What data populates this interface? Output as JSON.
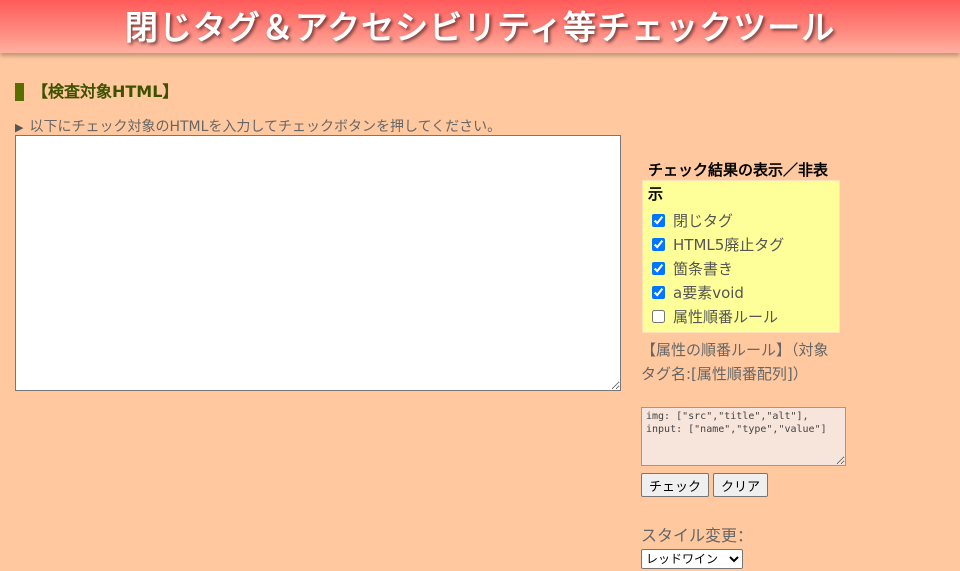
{
  "header": {
    "title": "閉じタグ＆アクセシビリティ等チェックツール"
  },
  "input_section": {
    "title": "【検査対象HTML】",
    "instruction": "以下にチェック対象のHTMLを入力してチェックボタンを押してください。",
    "input_value": ""
  },
  "display_toggle": {
    "title": "チェック結果の表示／非表示",
    "items": [
      {
        "label": "閉じタグ",
        "checked": true
      },
      {
        "label": "HTML5廃止タグ",
        "checked": true
      },
      {
        "label": "箇条書き",
        "checked": true
      },
      {
        "label": "a要素void",
        "checked": true
      },
      {
        "label": "属性順番ルール",
        "checked": false
      }
    ]
  },
  "attribute_rule": {
    "heading": "【属性の順番ルール】（対象タグ名:[属性順番配列]）",
    "value": "img: [\"src\",\"title\",\"alt\"],\ninput: [\"name\",\"type\",\"value\"]"
  },
  "buttons": {
    "check": "チェック",
    "clear": "クリア"
  },
  "style": {
    "label": "スタイル変更：",
    "selected": "レッドワイン"
  },
  "colors": {
    "background": "#ffc89f",
    "header": "#ff6b6b",
    "panel": "#ffff99",
    "accent": "#5a6e00"
  }
}
